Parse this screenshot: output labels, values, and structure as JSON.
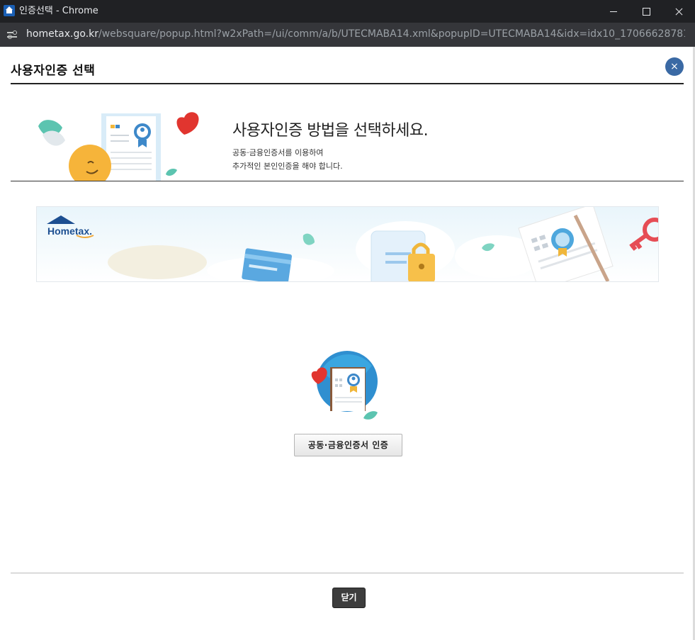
{
  "window": {
    "title": "인증선택 - Chrome",
    "url_host": "hometax.go.kr",
    "url_path": "/websquare/popup.html?w2xPath=/ui/comm/a/b/UTECMABA14.xml&popupID=UTECMABA14&idx=idx10_17066628781524335.80..."
  },
  "popup": {
    "title": "사용자인증 선택",
    "close_icon": "×"
  },
  "hero": {
    "heading": "사용자인증 방법을 선택하세요.",
    "desc_line1": "공동·금융인증서를 이용하여",
    "desc_line2": "추가적인 본인인증을 해야 합니다."
  },
  "banner": {
    "logo_text": "Hometax."
  },
  "actions": {
    "cert_button": "공동·금융인증서 인증",
    "close_button": "닫기"
  },
  "colors": {
    "titlebar": "#202124",
    "addressbar": "#35363a",
    "accent_blue": "#3a69a4",
    "close_button": "#3d3d3d"
  },
  "icons": [
    "home-favicon-icon",
    "tune-icon",
    "minimize-icon",
    "maximize-icon",
    "window-close-icon",
    "close-icon",
    "certificate-icon",
    "heart-icon",
    "leaf-icon",
    "padlock-icon",
    "key-icon",
    "card-icon"
  ]
}
